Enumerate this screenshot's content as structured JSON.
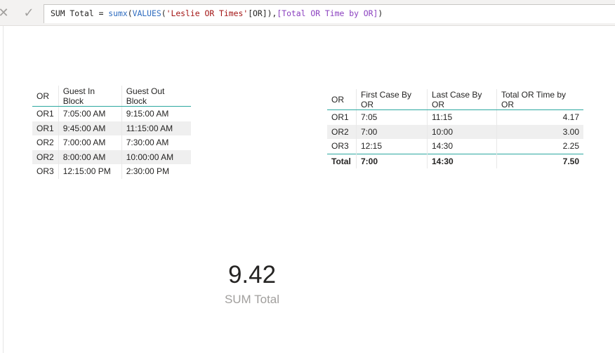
{
  "formula_bar": {
    "cancel_icon": "close-icon",
    "commit_icon": "check-icon",
    "tokens": [
      {
        "text": "SUM Total = ",
        "kind": "plain"
      },
      {
        "text": "sumx",
        "kind": "fn"
      },
      {
        "text": "(",
        "kind": "plain"
      },
      {
        "text": "VALUES",
        "kind": "fn"
      },
      {
        "text": "(",
        "kind": "plain"
      },
      {
        "text": "'Leslie OR Times'",
        "kind": "str"
      },
      {
        "text": "[OR]",
        "kind": "plain"
      },
      {
        "text": "),",
        "kind": "plain"
      },
      {
        "text": "[Total OR Time by OR]",
        "kind": "ref"
      },
      {
        "text": ")",
        "kind": "plain"
      }
    ]
  },
  "left_table": {
    "headers": [
      "OR",
      "Guest In Block",
      "Guest Out Block"
    ],
    "rows": [
      [
        "OR1",
        "7:05:00 AM",
        "9:15:00 AM"
      ],
      [
        "OR1",
        "9:45:00 AM",
        "11:15:00 AM"
      ],
      [
        "OR2",
        "7:00:00 AM",
        "7:30:00 AM"
      ],
      [
        "OR2",
        "8:00:00 AM",
        "10:00:00 AM"
      ],
      [
        "OR3",
        "12:15:00 PM",
        "2:30:00 PM"
      ]
    ]
  },
  "right_table": {
    "headers": [
      "OR",
      "First Case By OR",
      "Last Case By OR",
      "Total OR Time by OR"
    ],
    "rows": [
      [
        "OR1",
        "7:05",
        "11:15",
        "4.17"
      ],
      [
        "OR2",
        "7:00",
        "10:00",
        "3.00"
      ],
      [
        "OR3",
        "12:15",
        "14:30",
        "2.25"
      ]
    ],
    "total": [
      "Total",
      "7:00",
      "14:30",
      "7.50"
    ]
  },
  "card": {
    "value": "9.42",
    "label": "SUM Total"
  },
  "colors": {
    "header_rule": "#2ca8a0",
    "alt_row": "#efefef",
    "dax_function": "#2d6bbf",
    "dax_string": "#a31515",
    "dax_reference": "#8a3fbf"
  }
}
